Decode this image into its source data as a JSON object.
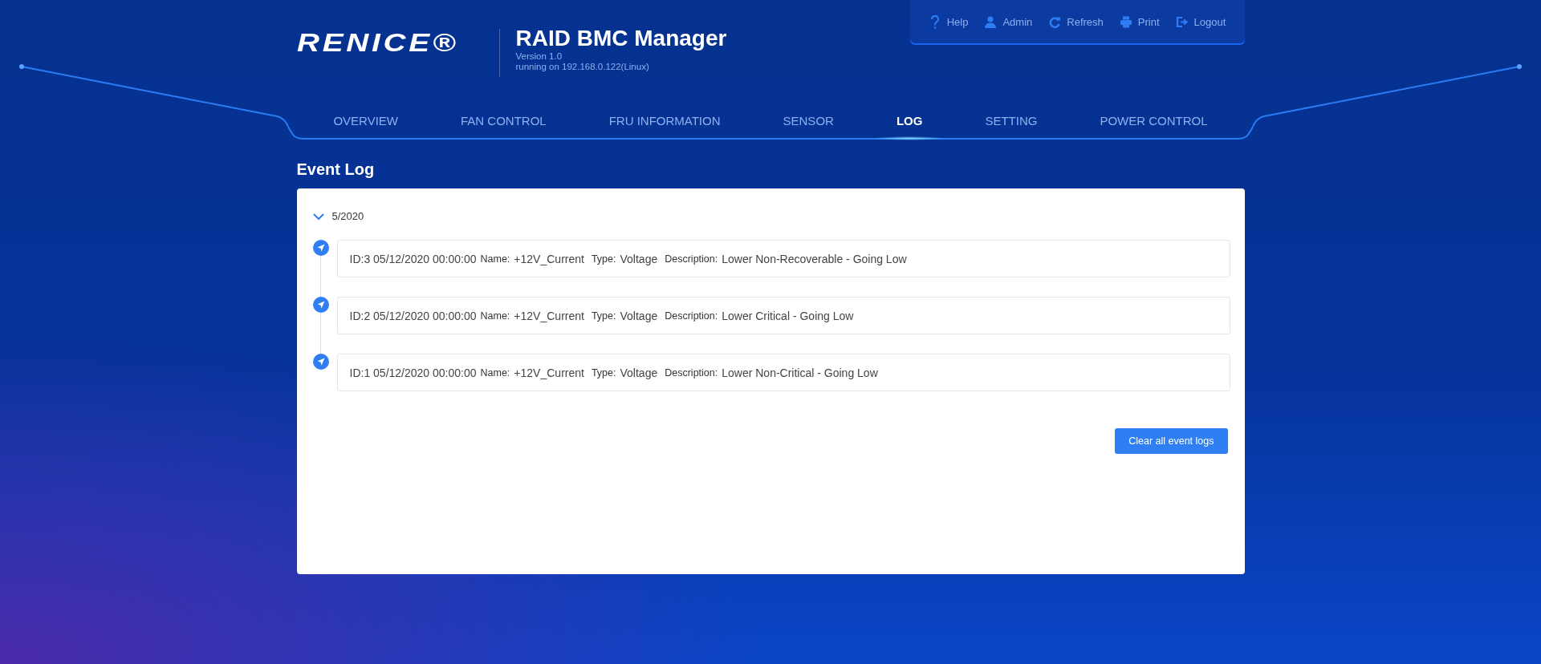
{
  "header": {
    "logo": "RENICE®",
    "title": "RAID BMC Manager",
    "version": "Version 1.0",
    "host": "running on 192.168.0.122(Linux)"
  },
  "toolbar": [
    {
      "kind": "help",
      "label": "Help"
    },
    {
      "kind": "user",
      "label": "Admin"
    },
    {
      "kind": "refresh",
      "label": "Refresh"
    },
    {
      "kind": "print",
      "label": "Print"
    },
    {
      "kind": "logout",
      "label": "Logout"
    }
  ],
  "tabs": [
    {
      "label": "OVERVIEW",
      "selected": false
    },
    {
      "label": "FAN CONTROL",
      "selected": false
    },
    {
      "label": "FRU INFORMATION",
      "selected": false
    },
    {
      "label": "SENSOR",
      "selected": false
    },
    {
      "label": "LOG",
      "selected": true
    },
    {
      "label": "SETTING",
      "selected": false
    },
    {
      "label": "POWER CONTROL",
      "selected": false
    }
  ],
  "page_title": "Event Log",
  "group": {
    "label": "5/2020",
    "expanded": true,
    "events": [
      {
        "head": "ID:3 05/12/2020 00:00:00",
        "name_label": "Name:",
        "name": "+12V_Current",
        "type_label": "Type:",
        "type": "Voltage",
        "description_label": "Description:",
        "description": "Lower Non-Recoverable - Going Low"
      },
      {
        "head": "ID:2 05/12/2020 00:00:00",
        "name_label": "Name:",
        "name": "+12V_Current",
        "type_label": "Type:",
        "type": "Voltage",
        "description_label": "Description:",
        "description": "Lower Critical - Going Low"
      },
      {
        "head": "ID:1 05/12/2020 00:00:00",
        "name_label": "Name:",
        "name": "+12V_Current",
        "type_label": "Type:",
        "type": "Voltage",
        "description_label": "Description:",
        "description": "Lower Non-Critical - Going Low"
      }
    ]
  },
  "clear_button": "Clear all event logs"
}
